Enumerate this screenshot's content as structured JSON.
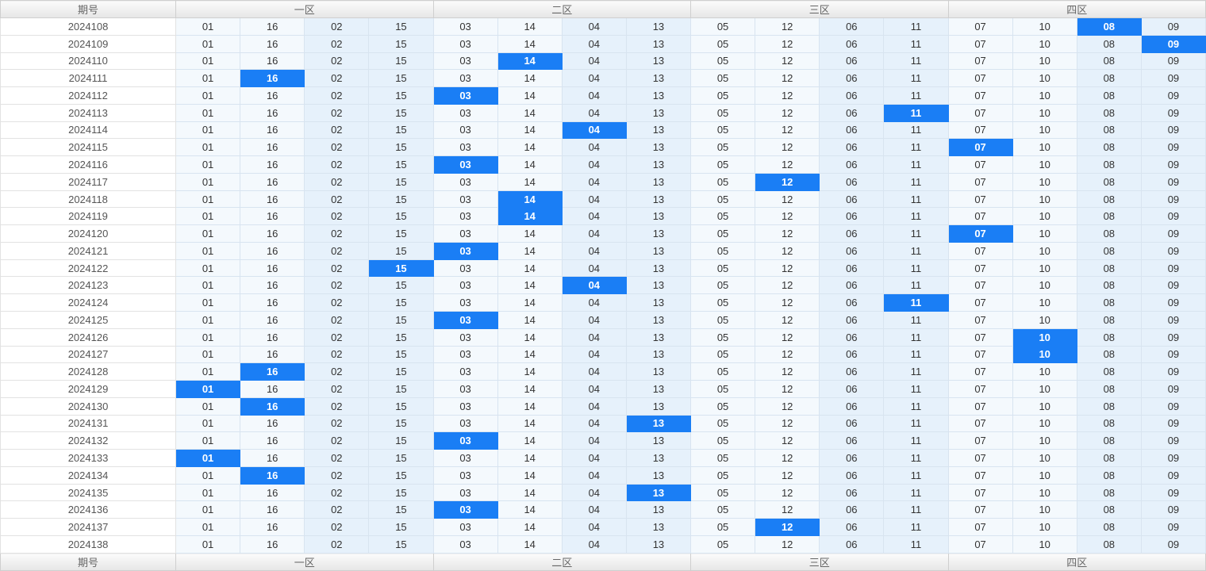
{
  "header": {
    "period_label": "期号",
    "zones": [
      {
        "label": "一区",
        "numbers": [
          "01",
          "16",
          "02",
          "15"
        ]
      },
      {
        "label": "二区",
        "numbers": [
          "03",
          "14",
          "04",
          "13"
        ]
      },
      {
        "label": "三区",
        "numbers": [
          "05",
          "12",
          "06",
          "11"
        ]
      },
      {
        "label": "四区",
        "numbers": [
          "07",
          "10",
          "08",
          "09"
        ]
      }
    ]
  },
  "rows": [
    {
      "period": "2024108",
      "hits": [
        "08"
      ]
    },
    {
      "period": "2024109",
      "hits": [
        "09"
      ]
    },
    {
      "period": "2024110",
      "hits": [
        "14"
      ]
    },
    {
      "period": "2024111",
      "hits": [
        "16"
      ]
    },
    {
      "period": "2024112",
      "hits": [
        "03"
      ]
    },
    {
      "period": "2024113",
      "hits": [
        "11"
      ]
    },
    {
      "period": "2024114",
      "hits": [
        "04"
      ]
    },
    {
      "period": "2024115",
      "hits": [
        "07"
      ]
    },
    {
      "period": "2024116",
      "hits": [
        "03"
      ]
    },
    {
      "period": "2024117",
      "hits": [
        "12"
      ]
    },
    {
      "period": "2024118",
      "hits": [
        "14"
      ]
    },
    {
      "period": "2024119",
      "hits": [
        "14"
      ]
    },
    {
      "period": "2024120",
      "hits": [
        "07"
      ]
    },
    {
      "period": "2024121",
      "hits": [
        "03"
      ]
    },
    {
      "period": "2024122",
      "hits": [
        "15"
      ]
    },
    {
      "period": "2024123",
      "hits": [
        "04"
      ]
    },
    {
      "period": "2024124",
      "hits": [
        "11"
      ]
    },
    {
      "period": "2024125",
      "hits": [
        "03"
      ]
    },
    {
      "period": "2024126",
      "hits": [
        "10"
      ]
    },
    {
      "period": "2024127",
      "hits": [
        "10"
      ]
    },
    {
      "period": "2024128",
      "hits": [
        "16"
      ]
    },
    {
      "period": "2024129",
      "hits": [
        "01"
      ]
    },
    {
      "period": "2024130",
      "hits": [
        "16"
      ]
    },
    {
      "period": "2024131",
      "hits": [
        "13"
      ]
    },
    {
      "period": "2024132",
      "hits": [
        "03"
      ]
    },
    {
      "period": "2024133",
      "hits": [
        "01"
      ]
    },
    {
      "period": "2024134",
      "hits": [
        "16"
      ]
    },
    {
      "period": "2024135",
      "hits": [
        "13"
      ]
    },
    {
      "period": "2024136",
      "hits": [
        "03"
      ]
    },
    {
      "period": "2024137",
      "hits": [
        "12"
      ]
    },
    {
      "period": "2024138",
      "hits": []
    }
  ],
  "colors": {
    "hit_background": "#1a7ef5",
    "hit_text": "#ffffff",
    "cell_light": "#f4f9fd",
    "cell_dark": "#e6f1fb",
    "zone_divider": "#444444"
  }
}
